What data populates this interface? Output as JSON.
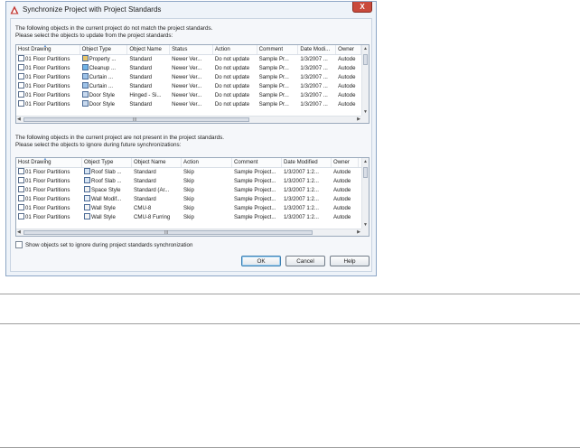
{
  "window": {
    "title": "Synchronize Project with Project Standards",
    "close_glyph": "X"
  },
  "section1": {
    "instruction_line1": "The following objects in the current project do not match the project standards.",
    "instruction_line2": "Please select the objects to update from the project standards:",
    "columns": [
      "Host Drawing",
      "Object Type",
      "Object Name",
      "Status",
      "Action",
      "Comment",
      "Date Modi...",
      "Owner"
    ],
    "rows": [
      [
        "01 Floor Partitions",
        "Property ...",
        "Standard",
        "Newer Ver...",
        "Do not update",
        "Sample Pr...",
        "1/3/2007 ...",
        "Autode"
      ],
      [
        "01 Floor Partitions",
        "Cleanup ...",
        "Standard",
        "Newer Ver...",
        "Do not update",
        "Sample Pr...",
        "1/3/2007 ...",
        "Autode"
      ],
      [
        "01 Floor Partitions",
        "Curtain ...",
        "Standard",
        "Newer Ver...",
        "Do not update",
        "Sample Pr...",
        "1/3/2007 ...",
        "Autode"
      ],
      [
        "01 Floor Partitions",
        "Curtain ...",
        "Standard",
        "Newer Ver...",
        "Do not update",
        "Sample Pr...",
        "1/3/2007 ...",
        "Autode"
      ],
      [
        "01 Floor Partitions",
        "Door Style",
        "Hinged - Si...",
        "Newer Ver...",
        "Do not update",
        "Sample Pr...",
        "1/3/2007 ...",
        "Autode"
      ],
      [
        "01 Floor Partitions",
        "Door Style",
        "Standard",
        "Newer Ver...",
        "Do not update",
        "Sample Pr...",
        "1/3/2007 ...",
        "Autode"
      ]
    ],
    "scroll_grip": "III"
  },
  "section2": {
    "instruction_line1": "The following objects in the current project are not present in the project standards.",
    "instruction_line2": "Please select the objects to ignore during future synchronizations:",
    "columns": [
      "Host Drawing",
      "Object Type",
      "Object Name",
      "Action",
      "Comment",
      "Date Modified",
      "Owner"
    ],
    "rows": [
      [
        "01 Floor Partitions",
        "Roof Slab ...",
        "Standard",
        "Skip",
        "Sample Project...",
        "1/3/2007 1:2...",
        "Autode"
      ],
      [
        "01 Floor Partitions",
        "Roof Slab ...",
        "Standard",
        "Skip",
        "Sample Project...",
        "1/3/2007 1:2...",
        "Autode"
      ],
      [
        "01 Floor Partitions",
        "Space Style",
        "Standard (Ar...",
        "Skip",
        "Sample Project...",
        "1/3/2007 1:2...",
        "Autode"
      ],
      [
        "01 Floor Partitions",
        "Wall Modif...",
        "Standard",
        "Skip",
        "Sample Project...",
        "1/3/2007 1:2...",
        "Autode"
      ],
      [
        "01 Floor Partitions",
        "Wall Style",
        "CMU-8",
        "Skip",
        "Sample Project...",
        "1/3/2007 1:2...",
        "Autode"
      ],
      [
        "01 Floor Partitions",
        "Wall Style",
        "CMU-8 Furring",
        "Skip",
        "Sample Project...",
        "1/3/2007 1:2...",
        "Autode"
      ]
    ],
    "scroll_grip": "III"
  },
  "checkbox": {
    "label": "Show objects set to ignore during project standards synchronization"
  },
  "buttons": {
    "ok": "OK",
    "cancel": "Cancel",
    "help": "Help"
  },
  "colors": {
    "accent": "#3c7fb1",
    "close": "#c94a3c"
  }
}
